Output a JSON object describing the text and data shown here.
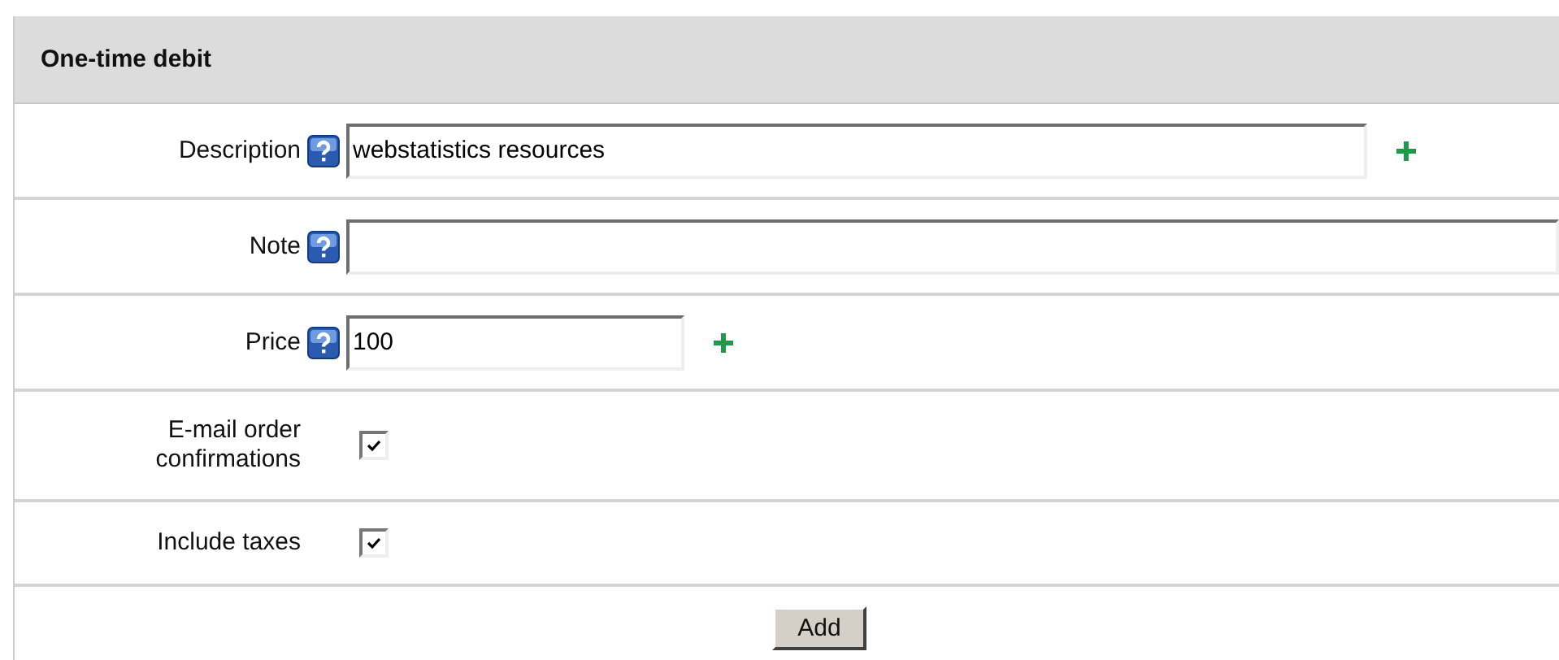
{
  "panel": {
    "title": "One-time debit"
  },
  "fields": [
    {
      "kind": "text",
      "label": "Description",
      "help": true,
      "value": "webstatistics resources",
      "addable": true
    },
    {
      "kind": "text",
      "label": "Note",
      "help": true
    },
    {
      "kind": "text",
      "label": "Price",
      "help": true,
      "value": "100",
      "addable": true
    },
    {
      "kind": "checkbox",
      "label": "E-mail order confirmations",
      "checked": true
    },
    {
      "kind": "checkbox",
      "label": "Include taxes",
      "checked": true
    }
  ],
  "buttons": [
    "Add"
  ]
}
